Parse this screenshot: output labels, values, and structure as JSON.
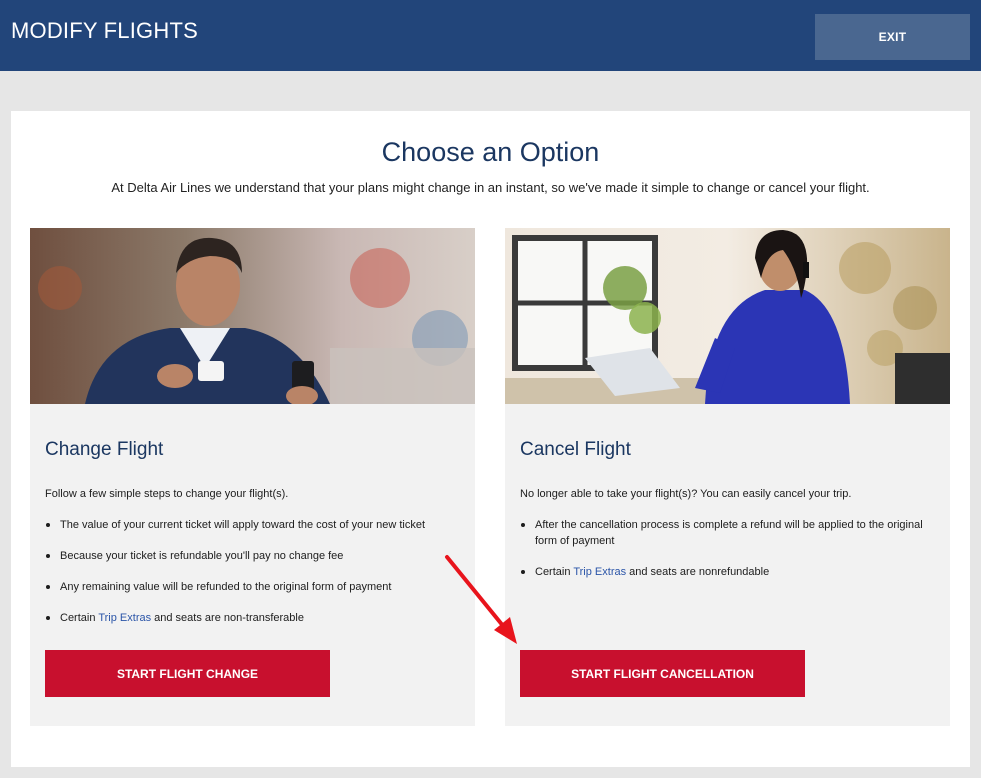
{
  "header": {
    "title": "MODIFY FLIGHTS",
    "exit_label": "EXIT"
  },
  "main": {
    "heading": "Choose an Option",
    "subtitle": "At Delta Air Lines we understand that your plans might change in an instant, so we've made it simple to change or cancel your flight."
  },
  "change_card": {
    "title": "Change Flight",
    "intro": "Follow a few simple steps to change your flight(s).",
    "bullets": [
      "The value of your current ticket will apply toward the cost of your new ticket",
      {
        "pre": "Because your ticket is ",
        "strong": "refundable",
        "post": " you'll pay no change fee"
      },
      "Any remaining value will be refunded to the original form of payment",
      {
        "pre": "Certain ",
        "link": "Trip Extras",
        "post": " and seats are ",
        "strong2": "non-transferable"
      }
    ],
    "button_label": "START FLIGHT CHANGE"
  },
  "cancel_card": {
    "title": "Cancel Flight",
    "intro": "No longer able to take your flight(s)?  You can easily cancel your trip.",
    "bullets": [
      "After the cancellation process is complete a refund will be applied to the original form of payment",
      {
        "pre": "Certain ",
        "link": "Trip Extras",
        "post": " and seats are ",
        "strong2": "nonrefundable"
      }
    ],
    "button_label": "START FLIGHT CANCELLATION"
  },
  "colors": {
    "header_bg": "#22457a",
    "accent_red": "#c8102e",
    "heading_blue": "#1b3761",
    "link_blue": "#2b55a8",
    "annotation_arrow": "#e8141c"
  }
}
